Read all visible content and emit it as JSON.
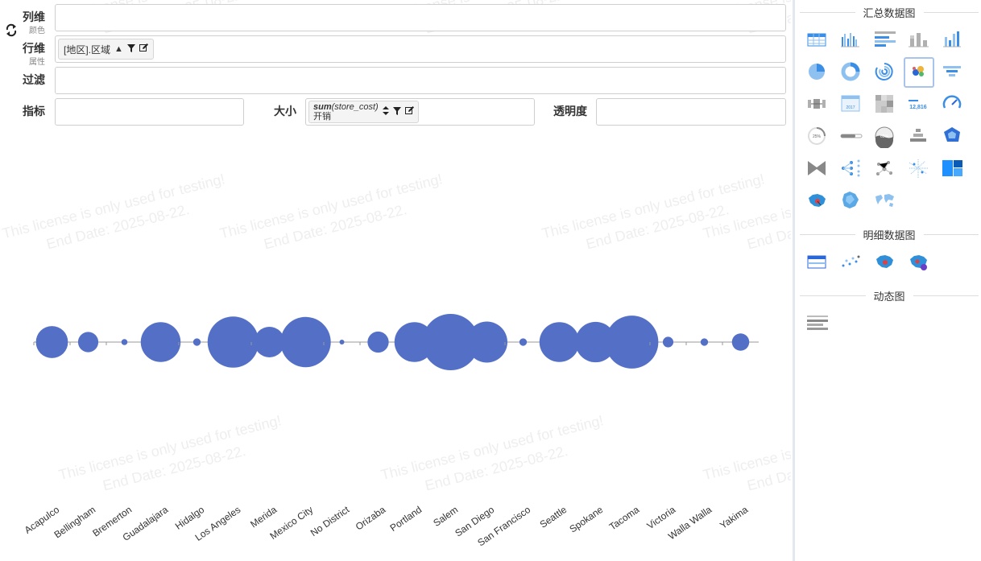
{
  "shelves": {
    "column": {
      "label": "列维",
      "sublabel": "颜色"
    },
    "row": {
      "label": "行维",
      "sublabel": "属性",
      "pill": "[地区].区域"
    },
    "filter": {
      "label": "过滤"
    },
    "measure": {
      "label": "指标"
    },
    "size": {
      "label": "大小",
      "pill_func": "sum",
      "pill_arg": "(store_cost)",
      "pill_alias": "开销"
    },
    "opacity": {
      "label": "透明度"
    }
  },
  "watermark": {
    "line1": "This license is only used for testing!",
    "line2": "End Date: 2025-08-22."
  },
  "sidebar": {
    "summary_title": "汇总数据图",
    "detail_title": "明细数据图",
    "dynamic_title": "动态图",
    "summary_icons": [
      "table-chart-icon",
      "grouped-bar-chart-icon",
      "bar-table-icon",
      "stacked-bar-chart-icon",
      "column-chart-icon",
      "pie-chart-icon",
      "donut-chart-icon",
      "radial-chart-icon",
      "bubble-chart-icon",
      "funnel-chart-icon",
      "box-plot-icon",
      "calendar-chart-icon",
      "heatmap-icon",
      "number-card-icon",
      "gauge-icon",
      "progress-circle-icon",
      "progress-bar-icon",
      "liquid-fill-icon",
      "pyramid-chart-icon",
      "radar-chart-icon",
      "sankey-chart-icon",
      "tree-chart-icon",
      "network-chart-icon",
      "scatter-map-icon",
      "treemap-icon",
      "china-map-icon",
      "region-map-icon",
      "world-map-icon"
    ],
    "detail_icons": [
      "detail-table-icon",
      "detail-scatter-icon",
      "detail-map-icon",
      "detail-map-plus-icon"
    ],
    "dynamic_icons": [
      "dynamic-bar-race-icon"
    ],
    "calendar_year": "2017",
    "number_card_value": "12,816",
    "progress_circle_value": "25%",
    "liquid_fill_value": "65%"
  },
  "chart_data": {
    "type": "scatter",
    "encoding": "bubble",
    "categories": [
      "Acapulco",
      "Bellingham",
      "Bremerton",
      "Guadalajara",
      "Hidalgo",
      "Los Angeles",
      "Merida",
      "Mexico City",
      "No District",
      "Orizaba",
      "Portland",
      "Salem",
      "San Diego",
      "San Francisco",
      "Seattle",
      "Spokane",
      "Tacoma",
      "Victoria",
      "Walla Walla",
      "Yakima"
    ],
    "size_field": "sum(store_cost) 开销",
    "values": [
      55,
      22,
      2,
      85,
      3,
      140,
      50,
      135,
      1,
      24,
      85,
      170,
      90,
      3,
      85,
      88,
      150,
      6,
      3,
      16
    ],
    "color": "#5470c6"
  }
}
